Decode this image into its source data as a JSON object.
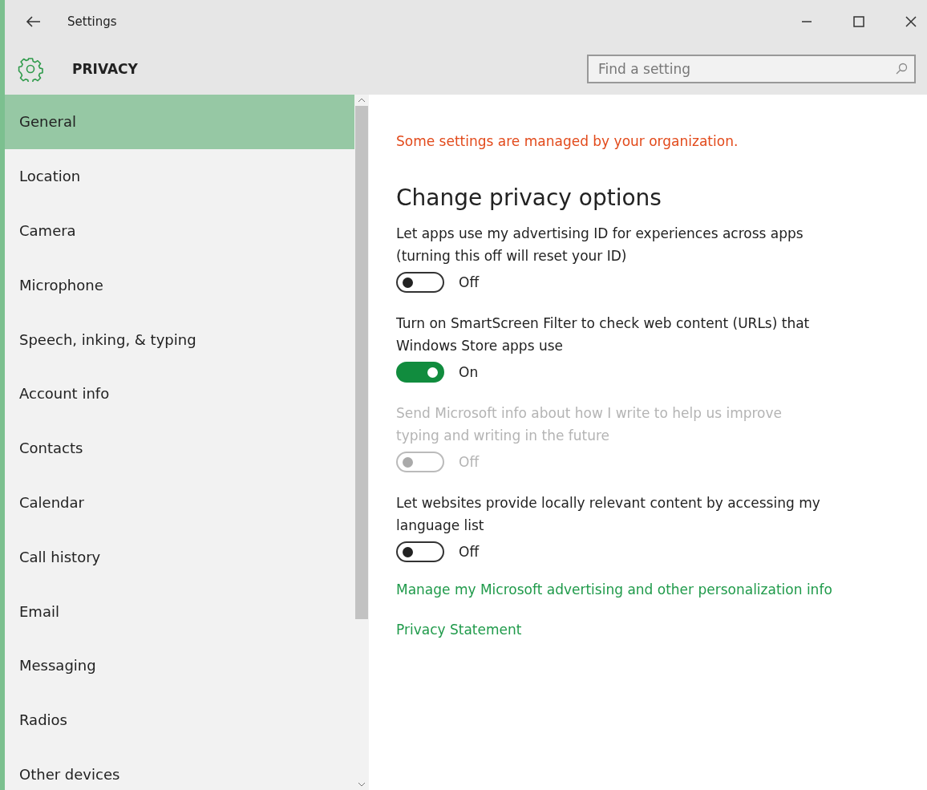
{
  "window": {
    "title": "Settings"
  },
  "header": {
    "title": "PRIVACY"
  },
  "search": {
    "placeholder": "Find a setting"
  },
  "sidebar": {
    "items": [
      {
        "label": "General",
        "selected": true
      },
      {
        "label": "Location",
        "selected": false
      },
      {
        "label": "Camera",
        "selected": false
      },
      {
        "label": "Microphone",
        "selected": false
      },
      {
        "label": "Speech, inking, & typing",
        "selected": false
      },
      {
        "label": "Account info",
        "selected": false
      },
      {
        "label": "Contacts",
        "selected": false
      },
      {
        "label": "Calendar",
        "selected": false
      },
      {
        "label": "Call history",
        "selected": false
      },
      {
        "label": "Email",
        "selected": false
      },
      {
        "label": "Messaging",
        "selected": false
      },
      {
        "label": "Radios",
        "selected": false
      },
      {
        "label": "Other devices",
        "selected": false
      }
    ]
  },
  "notice": "Some settings are managed by your organization.",
  "heading": "Change privacy options",
  "options": [
    {
      "label": "Let apps use my advertising ID for experiences across apps (turning this off will reset your ID)",
      "on": false,
      "disabled": false,
      "state": "Off"
    },
    {
      "label": "Turn on SmartScreen Filter to check web content (URLs) that Windows Store apps use",
      "on": true,
      "disabled": false,
      "state": "On"
    },
    {
      "label": "Send Microsoft info about how I write to help us improve typing and writing in the future",
      "on": false,
      "disabled": true,
      "state": "Off"
    },
    {
      "label": "Let websites provide locally relevant content by accessing my language list",
      "on": false,
      "disabled": false,
      "state": "Off"
    }
  ],
  "links": [
    "Manage my Microsoft advertising and other personalization info",
    "Privacy Statement"
  ]
}
